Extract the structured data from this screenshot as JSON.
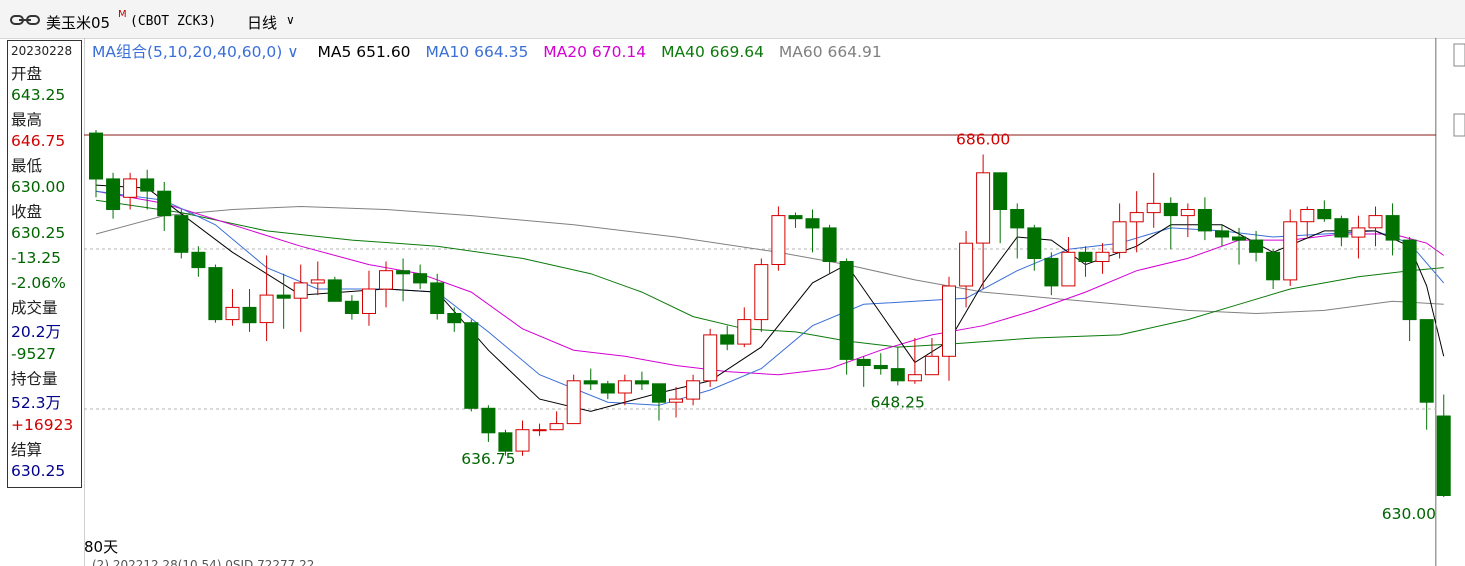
{
  "titlebar": {
    "symbol": "美玉米05",
    "superscript": "M",
    "code": "(CBOT ZCK3)",
    "period": "日线"
  },
  "info_panel": {
    "date": "20230228",
    "open_label": "开盘",
    "open": "643.25",
    "high_label": "最高",
    "high": "646.75",
    "low_label": "最低",
    "low": "630.00",
    "close_label": "收盘",
    "close": "630.25",
    "change": "-13.25",
    "change_pct": "-2.06%",
    "volume_label": "成交量",
    "volume": "20.2万",
    "volume_change": "-9527",
    "oi_label": "持仓量",
    "oi": "52.3万",
    "oi_change": "+16923",
    "settle_label": "结算",
    "settle": "630.25"
  },
  "legend": {
    "combo": "MA组合(5,10,20,40,60,0)",
    "ma5": "MA5 651.60",
    "ma10": "MA10 664.35",
    "ma20": "MA20 670.14",
    "ma40": "MA40 669.64",
    "ma60": "MA60 664.91"
  },
  "bottom": {
    "period_count": "80天",
    "cut_text": "(2) 202212 28(10 54) 0SID 72277 22"
  },
  "colors": {
    "up": "#d40000",
    "down": "#007000",
    "ma5": "#000000",
    "ma10": "#3a6fd8",
    "ma20": "#d400d4",
    "ma40": "#0b7a0b",
    "ma60": "#808080"
  },
  "chart_data": {
    "type": "candlestick",
    "ylim": [
      630.0,
      690.0
    ],
    "annotations": [
      {
        "text": "686.00",
        "candle": 52,
        "kind": "high"
      },
      {
        "text": "636.75",
        "candle": 23,
        "kind": "low"
      },
      {
        "text": "648.25",
        "candle": 47,
        "kind": "low"
      },
      {
        "text": "630.00",
        "candle": 79,
        "kind": "low"
      }
    ],
    "candles": [
      [
        689.5,
        682.0,
        690.0,
        679.0
      ],
      [
        682.0,
        677.0,
        683.0,
        675.5
      ],
      [
        679.0,
        682.0,
        683.0,
        677.0
      ],
      [
        682.0,
        680.0,
        683.5,
        677.0
      ],
      [
        680.0,
        676.0,
        681.5,
        673.5
      ],
      [
        676.0,
        670.0,
        677.0,
        669.0
      ],
      [
        670.0,
        667.5,
        671.0,
        666.0
      ],
      [
        667.5,
        659.0,
        668.0,
        658.5
      ],
      [
        659.0,
        661.0,
        664.0,
        658.0
      ],
      [
        661.0,
        658.5,
        664.0,
        657.0
      ],
      [
        658.5,
        663.0,
        669.5,
        655.5
      ],
      [
        663.0,
        662.5,
        666.5,
        657.5
      ],
      [
        662.5,
        665.0,
        668.0,
        657.0
      ],
      [
        665.0,
        665.5,
        668.5,
        663.0
      ],
      [
        665.5,
        662.0,
        666.0,
        662.0
      ],
      [
        662.0,
        660.0,
        663.0,
        659.0
      ],
      [
        660.0,
        664.0,
        667.0,
        658.0
      ],
      [
        664.0,
        667.0,
        668.5,
        661.0
      ],
      [
        667.0,
        666.5,
        669.0,
        662.0
      ],
      [
        666.5,
        665.0,
        668.0,
        664.0
      ],
      [
        665.0,
        660.0,
        666.5,
        659.0
      ],
      [
        660.0,
        658.5,
        661.0,
        657.0
      ],
      [
        658.5,
        644.5,
        659.0,
        644.0
      ],
      [
        644.5,
        640.5,
        645.0,
        639.0
      ],
      [
        640.5,
        637.5,
        641.0,
        636.75
      ],
      [
        637.5,
        641.0,
        642.5,
        636.75
      ],
      [
        641.0,
        641.0,
        642.0,
        640.0
      ],
      [
        641.0,
        642.0,
        644.0,
        641.0
      ],
      [
        642.0,
        649.0,
        650.0,
        642.0
      ],
      [
        649.0,
        648.5,
        651.0,
        647.5
      ],
      [
        648.5,
        647.0,
        649.0,
        646.0
      ],
      [
        647.0,
        649.0,
        650.0,
        645.0
      ],
      [
        649.0,
        648.5,
        650.5,
        647.5
      ],
      [
        648.5,
        645.5,
        648.5,
        642.5
      ],
      [
        645.5,
        646.0,
        648.0,
        643.0
      ],
      [
        646.0,
        649.0,
        650.0,
        645.0
      ],
      [
        649.0,
        656.5,
        657.5,
        648.0
      ],
      [
        656.5,
        655.0,
        658.0,
        654.0
      ],
      [
        655.0,
        659.0,
        661.0,
        654.5
      ],
      [
        659.0,
        668.0,
        669.0,
        657.0
      ],
      [
        668.0,
        676.0,
        677.5,
        667.0
      ],
      [
        676.0,
        675.5,
        676.5,
        674.0
      ],
      [
        675.5,
        674.0,
        677.0,
        670.0
      ],
      [
        674.0,
        668.5,
        674.5,
        666.5
      ],
      [
        668.5,
        652.5,
        669.0,
        650.0
      ],
      [
        652.5,
        651.5,
        653.0,
        648.0
      ],
      [
        651.5,
        651.0,
        653.5,
        650.0
      ],
      [
        651.0,
        649.0,
        654.5,
        648.25
      ],
      [
        649.0,
        650.0,
        656.0,
        648.5
      ],
      [
        650.0,
        653.0,
        656.0,
        652.0
      ],
      [
        653.0,
        664.5,
        666.0,
        649.0
      ],
      [
        664.5,
        671.5,
        673.5,
        661.0
      ],
      [
        671.5,
        683.0,
        686.0,
        664.0
      ],
      [
        683.0,
        677.0,
        683.0,
        671.5
      ],
      [
        677.0,
        674.0,
        678.0,
        669.0
      ],
      [
        674.0,
        669.0,
        674.5,
        667.0
      ],
      [
        669.0,
        664.5,
        670.0,
        663.0
      ],
      [
        664.5,
        670.0,
        672.5,
        664.5
      ],
      [
        670.0,
        668.5,
        671.0,
        666.0
      ],
      [
        668.5,
        670.0,
        671.5,
        666.5
      ],
      [
        670.0,
        675.0,
        678.0,
        669.0
      ],
      [
        675.0,
        676.5,
        680.0,
        670.0
      ],
      [
        676.5,
        678.0,
        683.0,
        674.0
      ],
      [
        678.0,
        676.0,
        679.0,
        670.5
      ],
      [
        676.0,
        677.0,
        678.0,
        672.5
      ],
      [
        677.0,
        673.5,
        679.0,
        672.0
      ],
      [
        673.5,
        672.5,
        674.5,
        671.0
      ],
      [
        672.5,
        672.0,
        674.0,
        668.0
      ],
      [
        672.0,
        670.0,
        673.5,
        668.5
      ],
      [
        670.0,
        665.5,
        670.5,
        664.0
      ],
      [
        665.5,
        675.0,
        677.0,
        664.5
      ],
      [
        675.0,
        677.0,
        677.5,
        672.5
      ],
      [
        677.0,
        675.5,
        678.5,
        675.0
      ],
      [
        675.5,
        672.5,
        676.0,
        671.0
      ],
      [
        672.5,
        674.0,
        676.0,
        669.0
      ],
      [
        674.0,
        676.0,
        677.5,
        671.0
      ],
      [
        676.0,
        672.0,
        678.0,
        669.5
      ],
      [
        672.0,
        659.0,
        672.5,
        655.5
      ],
      [
        659.0,
        645.5,
        659.0,
        641.0
      ],
      [
        643.25,
        630.25,
        646.75,
        630.0
      ]
    ],
    "ma5": [
      [
        0,
        681.0
      ],
      [
        3,
        680.5
      ],
      [
        8,
        670.0
      ],
      [
        12,
        663.0
      ],
      [
        17,
        664.0
      ],
      [
        20,
        663.5
      ],
      [
        23,
        654.0
      ],
      [
        26,
        646.0
      ],
      [
        29,
        644.0
      ],
      [
        33,
        647.0
      ],
      [
        36,
        649.0
      ],
      [
        39,
        654.5
      ],
      [
        42,
        665.0
      ],
      [
        44,
        668.0
      ],
      [
        46,
        660.0
      ],
      [
        48,
        652.0
      ],
      [
        50,
        655.5
      ],
      [
        52,
        665.0
      ],
      [
        54,
        672.5
      ],
      [
        56,
        672.0
      ],
      [
        58,
        668.0
      ],
      [
        61,
        671.0
      ],
      [
        63,
        674.5
      ],
      [
        66,
        674.5
      ],
      [
        69,
        670.0
      ],
      [
        72,
        673.5
      ],
      [
        75,
        673.5
      ],
      [
        77,
        671.0
      ],
      [
        78,
        664.5
      ],
      [
        79,
        653.0
      ]
    ],
    "ma10": [
      [
        0,
        680.0
      ],
      [
        4,
        678.5
      ],
      [
        7,
        674.5
      ],
      [
        10,
        667.5
      ],
      [
        13,
        664.0
      ],
      [
        17,
        664.0
      ],
      [
        20,
        663.5
      ],
      [
        23,
        657.0
      ],
      [
        26,
        650.0
      ],
      [
        30,
        645.5
      ],
      [
        33,
        645.0
      ],
      [
        36,
        647.5
      ],
      [
        39,
        651.0
      ],
      [
        42,
        658.0
      ],
      [
        45,
        661.5
      ],
      [
        48,
        662.0
      ],
      [
        51,
        662.5
      ],
      [
        54,
        667.0
      ],
      [
        57,
        670.5
      ],
      [
        60,
        671.5
      ],
      [
        63,
        674.0
      ],
      [
        66,
        673.5
      ],
      [
        69,
        672.5
      ],
      [
        72,
        673.0
      ],
      [
        75,
        673.5
      ],
      [
        77,
        671.5
      ],
      [
        79,
        665.0
      ]
    ],
    "ma20": [
      [
        0,
        680.0
      ],
      [
        4,
        678.0
      ],
      [
        8,
        674.5
      ],
      [
        12,
        671.0
      ],
      [
        16,
        668.0
      ],
      [
        19,
        666.5
      ],
      [
        22,
        663.5
      ],
      [
        25,
        657.5
      ],
      [
        28,
        654.0
      ],
      [
        31,
        653.0
      ],
      [
        34,
        651.5
      ],
      [
        37,
        650.5
      ],
      [
        40,
        650.0
      ],
      [
        43,
        651.0
      ],
      [
        46,
        654.0
      ],
      [
        49,
        656.5
      ],
      [
        52,
        658.0
      ],
      [
        55,
        660.5
      ],
      [
        58,
        663.5
      ],
      [
        61,
        667.0
      ],
      [
        64,
        669.0
      ],
      [
        67,
        672.0
      ],
      [
        70,
        672.0
      ],
      [
        73,
        673.0
      ],
      [
        76,
        673.0
      ],
      [
        78,
        671.5
      ],
      [
        79,
        669.5
      ]
    ],
    "ma40": [
      [
        0,
        678.5
      ],
      [
        5,
        676.5
      ],
      [
        10,
        673.5
      ],
      [
        15,
        672.0
      ],
      [
        20,
        671.0
      ],
      [
        25,
        669.0
      ],
      [
        29,
        666.5
      ],
      [
        32,
        663.5
      ],
      [
        35,
        659.5
      ],
      [
        38,
        657.5
      ],
      [
        41,
        657.0
      ],
      [
        44,
        655.5
      ],
      [
        47,
        654.5
      ],
      [
        50,
        655.0
      ],
      [
        55,
        656.0
      ],
      [
        60,
        656.5
      ],
      [
        64,
        659.0
      ],
      [
        67,
        661.5
      ],
      [
        70,
        664.0
      ],
      [
        74,
        666.0
      ],
      [
        77,
        667.0
      ],
      [
        79,
        667.5
      ]
    ],
    "ma60": [
      [
        0,
        673.0
      ],
      [
        4,
        676.0
      ],
      [
        8,
        677.0
      ],
      [
        12,
        677.5
      ],
      [
        17,
        677.0
      ],
      [
        22,
        676.0
      ],
      [
        28,
        674.5
      ],
      [
        34,
        672.5
      ],
      [
        40,
        670.0
      ],
      [
        44,
        668.0
      ],
      [
        48,
        665.5
      ],
      [
        52,
        663.5
      ],
      [
        56,
        662.5
      ],
      [
        60,
        661.5
      ],
      [
        64,
        660.5
      ],
      [
        68,
        660.0
      ],
      [
        72,
        660.5
      ],
      [
        76,
        662.0
      ],
      [
        79,
        661.5
      ]
    ]
  }
}
